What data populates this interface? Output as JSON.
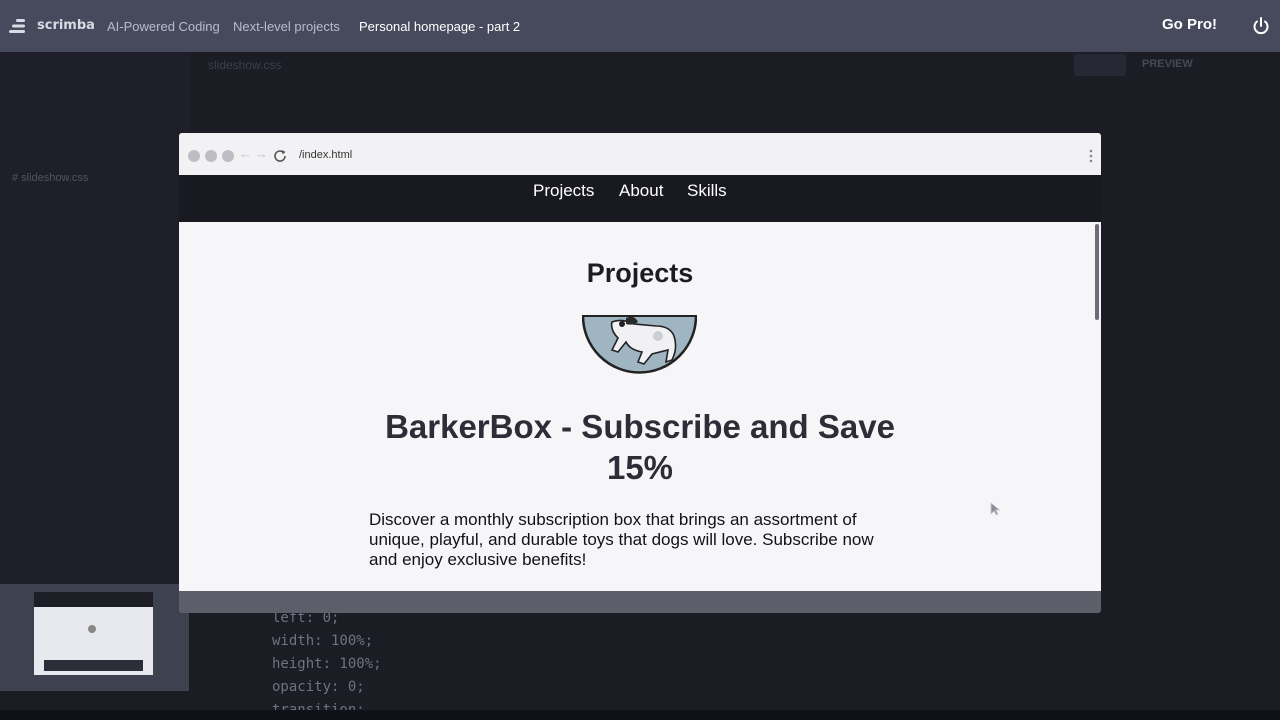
{
  "topbar": {
    "brand": "scrimba",
    "breadcrumbs": [
      "AI-Powered Coding",
      "Next-level projects",
      "Personal homepage - part 2"
    ],
    "go_pro": "Go Pro!"
  },
  "editor": {
    "sidebar_file": "# slideshow.css",
    "tab_filename": "slideshow.css",
    "preview_label": "PREVIEW",
    "code_lines": [
      "left: 0;",
      "width: 100%;",
      "height: 100%;",
      "opacity: 0;",
      "transition:"
    ]
  },
  "browser": {
    "url": "/index.html",
    "nav": [
      "Projects",
      "About",
      "Skills"
    ],
    "section_title": "Projects",
    "project_title": "BarkerBox - Subscribe and Save 15%",
    "project_description": "Discover a monthly subscription box that brings an assortment of unique, playful, and durable toys that dogs will love. Subscribe now and enjoy exclusive benefits!"
  },
  "colors": {
    "topbar_bg": "#474a5c",
    "editor_bg": "#1b1c24",
    "site_nav_bg": "#191a21",
    "page_bg": "#f6f6f8",
    "avatar_fill": "#9fb6c2"
  },
  "icons": [
    "scrimba-logo-icon",
    "power-icon",
    "reload-icon",
    "back-arrow-icon",
    "forward-arrow-icon",
    "kebab-menu-icon",
    "cursor-icon"
  ]
}
